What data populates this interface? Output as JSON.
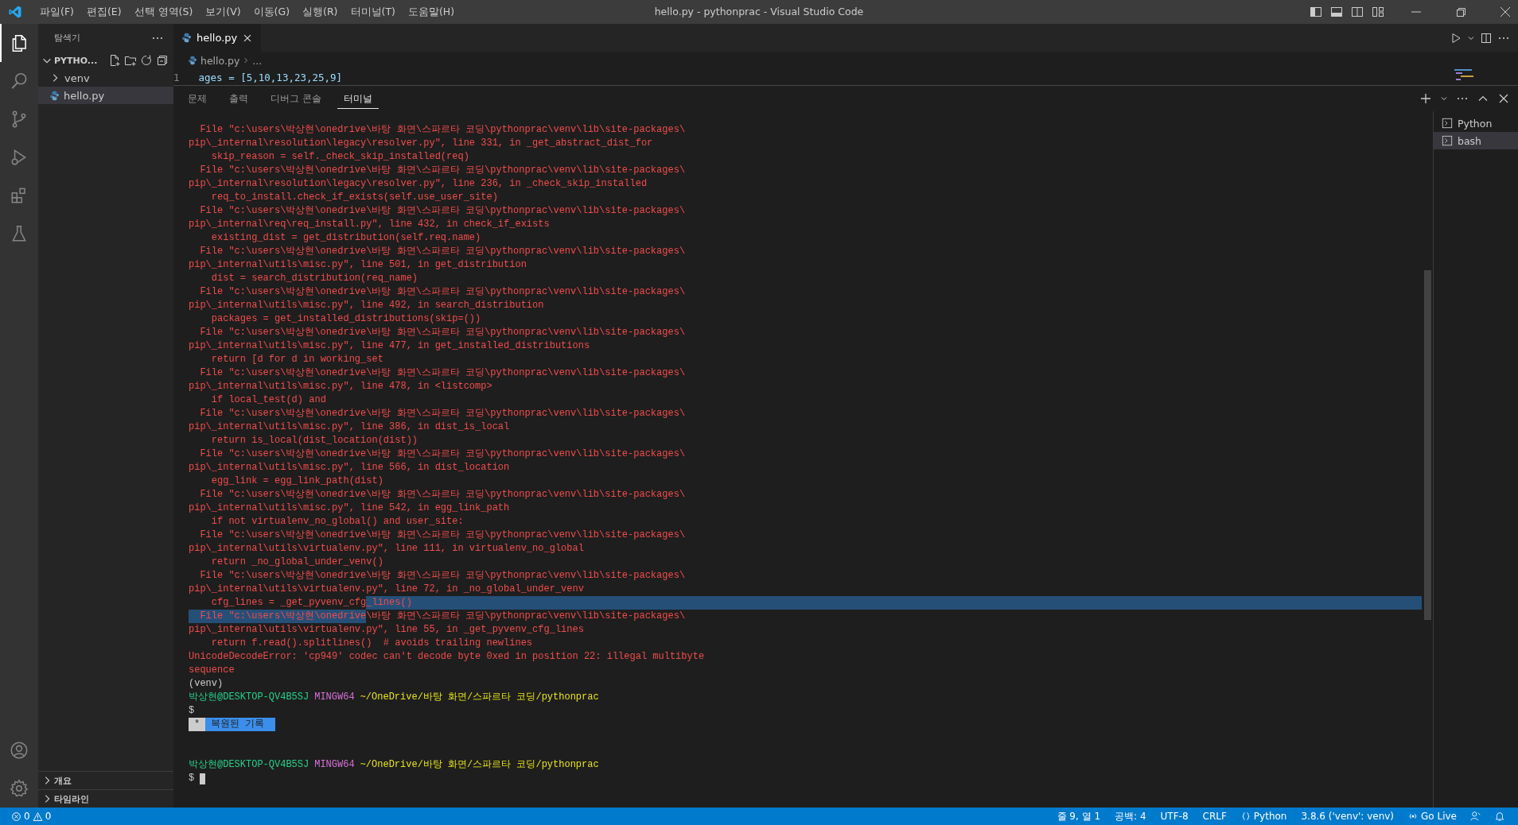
{
  "window": {
    "title": "hello.py - pythonprac - Visual Studio Code",
    "menu": [
      "파일(F)",
      "편집(E)",
      "선택 영역(S)",
      "보기(V)",
      "이동(G)",
      "실행(R)",
      "터미널(T)",
      "도움말(H)"
    ]
  },
  "activity_bar": {
    "top": [
      {
        "kind": "explorer",
        "selected": true
      },
      {
        "kind": "search",
        "selected": false
      },
      {
        "kind": "source-control",
        "selected": false
      },
      {
        "kind": "run",
        "selected": false
      },
      {
        "kind": "extensions",
        "selected": false
      },
      {
        "kind": "testing",
        "selected": false
      }
    ],
    "bottom": [
      {
        "kind": "account"
      },
      {
        "kind": "settings"
      }
    ]
  },
  "sidebar": {
    "title": "탐색기",
    "folder": {
      "label": "PYTHO...",
      "expanded": true,
      "children": [
        {
          "label": "venv",
          "kind": "folder",
          "expanded": false,
          "selected": false
        },
        {
          "label": "hello.py",
          "kind": "python",
          "selected": true
        }
      ]
    },
    "sections": [
      {
        "label": "개요",
        "expanded": false
      },
      {
        "label": "타임라인",
        "expanded": false
      }
    ]
  },
  "editor": {
    "tabs": [
      {
        "label": "hello.py",
        "selected": true
      }
    ],
    "breadcrumb": [
      "hello.py",
      "..."
    ],
    "lines": [
      {
        "number": "1",
        "text": "ages = [5,10,13,23,25,9]"
      }
    ]
  },
  "panel": {
    "tabs": [
      {
        "label": "문제",
        "selected": false
      },
      {
        "label": "출력",
        "selected": false
      },
      {
        "label": "디버그 콘솔",
        "selected": false
      },
      {
        "label": "터미널",
        "selected": true
      }
    ],
    "terminals": [
      {
        "label": "Python",
        "selected": false
      },
      {
        "label": "bash",
        "selected": true
      }
    ],
    "terminal": {
      "lines": [
        {
          "kind": "error",
          "text": "  File \"c:\\users\\박상현\\onedrive\\바탕 화면\\스파르타 코딩\\pythonprac\\venv\\lib\\site-packages\\"
        },
        {
          "kind": "error",
          "text": "pip\\_internal\\resolution\\legacy\\resolver.py\", line 331, in _get_abstract_dist_for"
        },
        {
          "kind": "error",
          "text": "    skip_reason = self._check_skip_installed(req)"
        },
        {
          "kind": "error",
          "text": "  File \"c:\\users\\박상현\\onedrive\\바탕 화면\\스파르타 코딩\\pythonprac\\venv\\lib\\site-packages\\"
        },
        {
          "kind": "error",
          "text": "pip\\_internal\\resolution\\legacy\\resolver.py\", line 236, in _check_skip_installed"
        },
        {
          "kind": "error",
          "text": "    req_to_install.check_if_exists(self.use_user_site)"
        },
        {
          "kind": "error",
          "text": "  File \"c:\\users\\박상현\\onedrive\\바탕 화면\\스파르타 코딩\\pythonprac\\venv\\lib\\site-packages\\"
        },
        {
          "kind": "error",
          "text": "pip\\_internal\\req\\req_install.py\", line 432, in check_if_exists"
        },
        {
          "kind": "error",
          "text": "    existing_dist = get_distribution(self.req.name)"
        },
        {
          "kind": "error",
          "text": "  File \"c:\\users\\박상현\\onedrive\\바탕 화면\\스파르타 코딩\\pythonprac\\venv\\lib\\site-packages\\"
        },
        {
          "kind": "error",
          "text": "pip\\_internal\\utils\\misc.py\", line 501, in get_distribution"
        },
        {
          "kind": "error",
          "text": "    dist = search_distribution(req_name)"
        },
        {
          "kind": "error",
          "text": "  File \"c:\\users\\박상현\\onedrive\\바탕 화면\\스파르타 코딩\\pythonprac\\venv\\lib\\site-packages\\"
        },
        {
          "kind": "error",
          "text": "pip\\_internal\\utils\\misc.py\", line 492, in search_distribution"
        },
        {
          "kind": "error",
          "text": "    packages = get_installed_distributions(skip=())"
        },
        {
          "kind": "error",
          "text": "  File \"c:\\users\\박상현\\onedrive\\바탕 화면\\스파르타 코딩\\pythonprac\\venv\\lib\\site-packages\\"
        },
        {
          "kind": "error",
          "text": "pip\\_internal\\utils\\misc.py\", line 477, in get_installed_distributions"
        },
        {
          "kind": "error",
          "text": "    return [d for d in working_set"
        },
        {
          "kind": "error",
          "text": "  File \"c:\\users\\박상현\\onedrive\\바탕 화면\\스파르타 코딩\\pythonprac\\venv\\lib\\site-packages\\"
        },
        {
          "kind": "error",
          "text": "pip\\_internal\\utils\\misc.py\", line 478, in <listcomp>"
        },
        {
          "kind": "error",
          "text": "    if local_test(d) and"
        },
        {
          "kind": "error",
          "text": "  File \"c:\\users\\박상현\\onedrive\\바탕 화면\\스파르타 코딩\\pythonprac\\venv\\lib\\site-packages\\"
        },
        {
          "kind": "error",
          "text": "pip\\_internal\\utils\\misc.py\", line 386, in dist_is_local"
        },
        {
          "kind": "error",
          "text": "    return is_local(dist_location(dist))"
        },
        {
          "kind": "error",
          "text": "  File \"c:\\users\\박상현\\onedrive\\바탕 화면\\스파르타 코딩\\pythonprac\\venv\\lib\\site-packages\\"
        },
        {
          "kind": "error",
          "text": "pip\\_internal\\utils\\misc.py\", line 566, in dist_location"
        },
        {
          "kind": "error",
          "text": "    egg_link = egg_link_path(dist)"
        },
        {
          "kind": "error",
          "text": "  File \"c:\\users\\박상현\\onedrive\\바탕 화면\\스파르타 코딩\\pythonprac\\venv\\lib\\site-packages\\"
        },
        {
          "kind": "error",
          "text": "pip\\_internal\\utils\\misc.py\", line 542, in egg_link_path"
        },
        {
          "kind": "error",
          "text": "    if not virtualenv_no_global() and user_site:"
        },
        {
          "kind": "error",
          "text": "  File \"c:\\users\\박상현\\onedrive\\바탕 화면\\스파르타 코딩\\pythonprac\\venv\\lib\\site-packages\\"
        },
        {
          "kind": "error",
          "text": "pip\\_internal\\utils\\virtualenv.py\", line 111, in virtualenv_no_global"
        },
        {
          "kind": "error",
          "text": "    return _no_global_under_venv()"
        },
        {
          "kind": "error",
          "text": "  File \"c:\\users\\박상현\\onedrive\\바탕 화면\\스파르타 코딩\\pythonprac\\venv\\lib\\site-packages\\"
        },
        {
          "kind": "error",
          "text": "pip\\_internal\\utils\\virtualenv.py\", line 72, in _no_global_under_venv"
        },
        {
          "kind": "error",
          "parts": [
            {
              "text": "    cfg_lines = _get_pyvenv_cfg",
              "selected": false
            },
            {
              "text": "_lines()",
              "selected": true
            }
          ]
        },
        {
          "kind": "error",
          "parts": [
            {
              "text": "  File \"c:\\users\\박상현\\onedrive",
              "selected": true
            },
            {
              "text": "\\바탕 화면\\스파르타 코딩\\pythonprac\\venv\\lib\\site-packages\\",
              "selected": false
            }
          ]
        },
        {
          "kind": "error",
          "text": "pip\\_internal\\utils\\virtualenv.py\", line 55, in _get_pyvenv_cfg_lines"
        },
        {
          "kind": "error",
          "text": "    return f.read().splitlines()  # avoids trailing newlines"
        },
        {
          "kind": "error",
          "text": "UnicodeDecodeError: 'cp949' codec can't decode byte 0xed in position 22: illegal multibyte"
        },
        {
          "kind": "error",
          "text": "sequence"
        },
        {
          "kind": "output",
          "text": "(venv)"
        },
        {
          "kind": "prompt",
          "user": "박상현@DESKTOP-QV4B5SJ",
          "system": "MINGW64",
          "path": "~/OneDrive/바탕 화면/스파르타 코딩/pythonprac"
        },
        {
          "kind": "output",
          "text": "$"
        },
        {
          "kind": "restored",
          "mark": "*",
          "text": "복원된 기록"
        },
        {
          "kind": "blank"
        },
        {
          "kind": "blank"
        },
        {
          "kind": "prompt",
          "user": "박상현@DESKTOP-QV4B5SJ",
          "system": "MINGW64",
          "path": "~/OneDrive/바탕 화면/스파르타 코딩/pythonprac"
        },
        {
          "kind": "input",
          "text": "$"
        }
      ]
    }
  },
  "status_bar": {
    "errors": "0",
    "warnings": "0",
    "items": [
      {
        "kind": "text",
        "text": "줄 9, 열 1"
      },
      {
        "kind": "text",
        "text": "공백: 4"
      },
      {
        "kind": "text",
        "text": "UTF-8"
      },
      {
        "kind": "text",
        "text": "CRLF"
      },
      {
        "kind": "language",
        "text": "Python"
      },
      {
        "kind": "text",
        "text": "3.8.6 ('venv': venv)"
      },
      {
        "kind": "live",
        "text": "Go Live"
      },
      {
        "kind": "feedback"
      },
      {
        "kind": "bell"
      }
    ]
  }
}
